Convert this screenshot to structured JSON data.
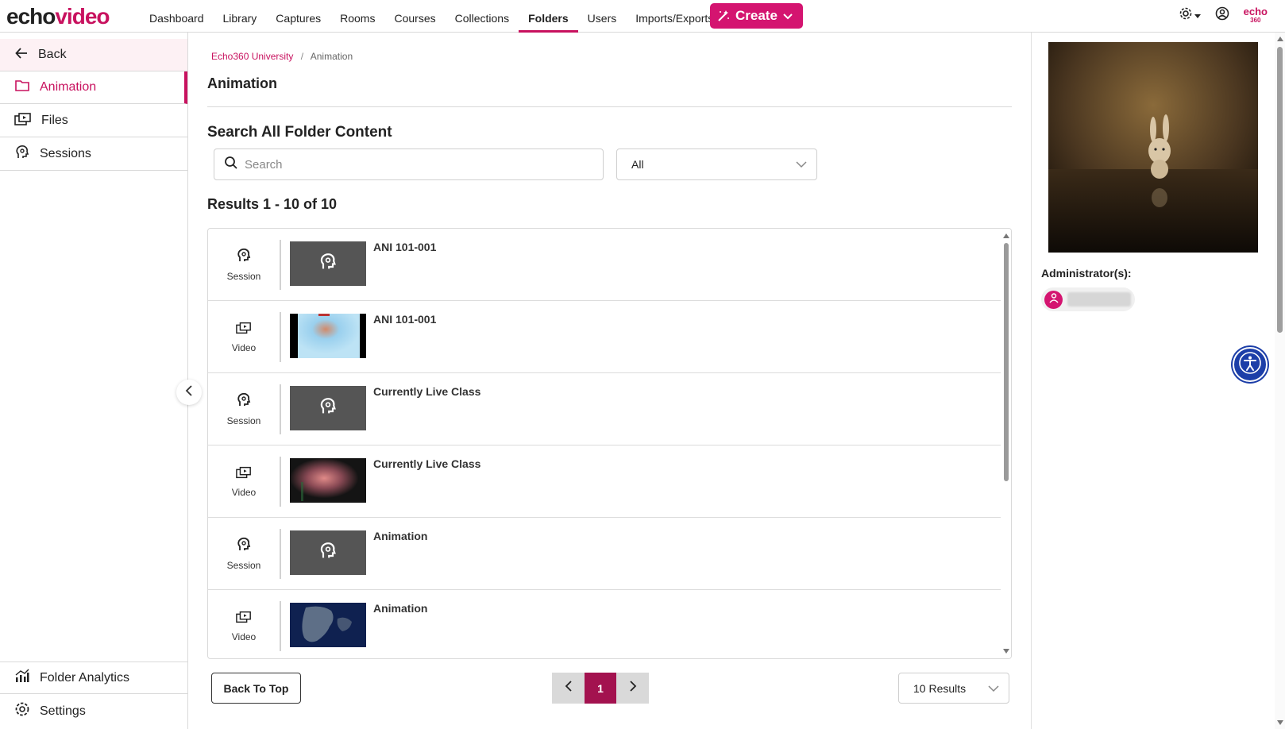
{
  "app": {
    "logo_part1": "echo",
    "logo_part2": "video",
    "brand_color": "#c8125f",
    "mini_logo_top": "echo",
    "mini_logo_bottom": "360"
  },
  "nav": {
    "items": [
      "Dashboard",
      "Library",
      "Captures",
      "Rooms",
      "Courses",
      "Collections",
      "Folders",
      "Users",
      "Imports/Exports"
    ],
    "active": "Folders",
    "create_label": "Create"
  },
  "sidebar": {
    "back_label": "Back",
    "active_label": "Animation",
    "files_label": "Files",
    "sessions_label": "Sessions",
    "analytics_label": "Folder Analytics",
    "settings_label": "Settings"
  },
  "breadcrumb": {
    "root": "Echo360 University",
    "separator": "/",
    "current": "Animation"
  },
  "main": {
    "page_title": "Animation",
    "section_title": "Search All Folder Content",
    "search_placeholder": "Search",
    "filter_value": "All",
    "results_label": "Results 1 - 10 of 10"
  },
  "results": [
    {
      "type": "Session",
      "title": "ANI 101-001",
      "thumb": "session-icon"
    },
    {
      "type": "Video",
      "title": "ANI 101-001",
      "thumb": "video-still-blue"
    },
    {
      "type": "Session",
      "title": "Currently Live Class",
      "thumb": "session-icon"
    },
    {
      "type": "Video",
      "title": "Currently Live Class",
      "thumb": "video-still-red"
    },
    {
      "type": "Session",
      "title": "Animation",
      "thumb": "session-icon"
    },
    {
      "type": "Video",
      "title": "Animation",
      "thumb": "video-still-map"
    }
  ],
  "pagination": {
    "back_to_top": "Back To Top",
    "current_page": "1",
    "per_page": "10 Results"
  },
  "right_panel": {
    "admin_label": "Administrator(s):"
  }
}
